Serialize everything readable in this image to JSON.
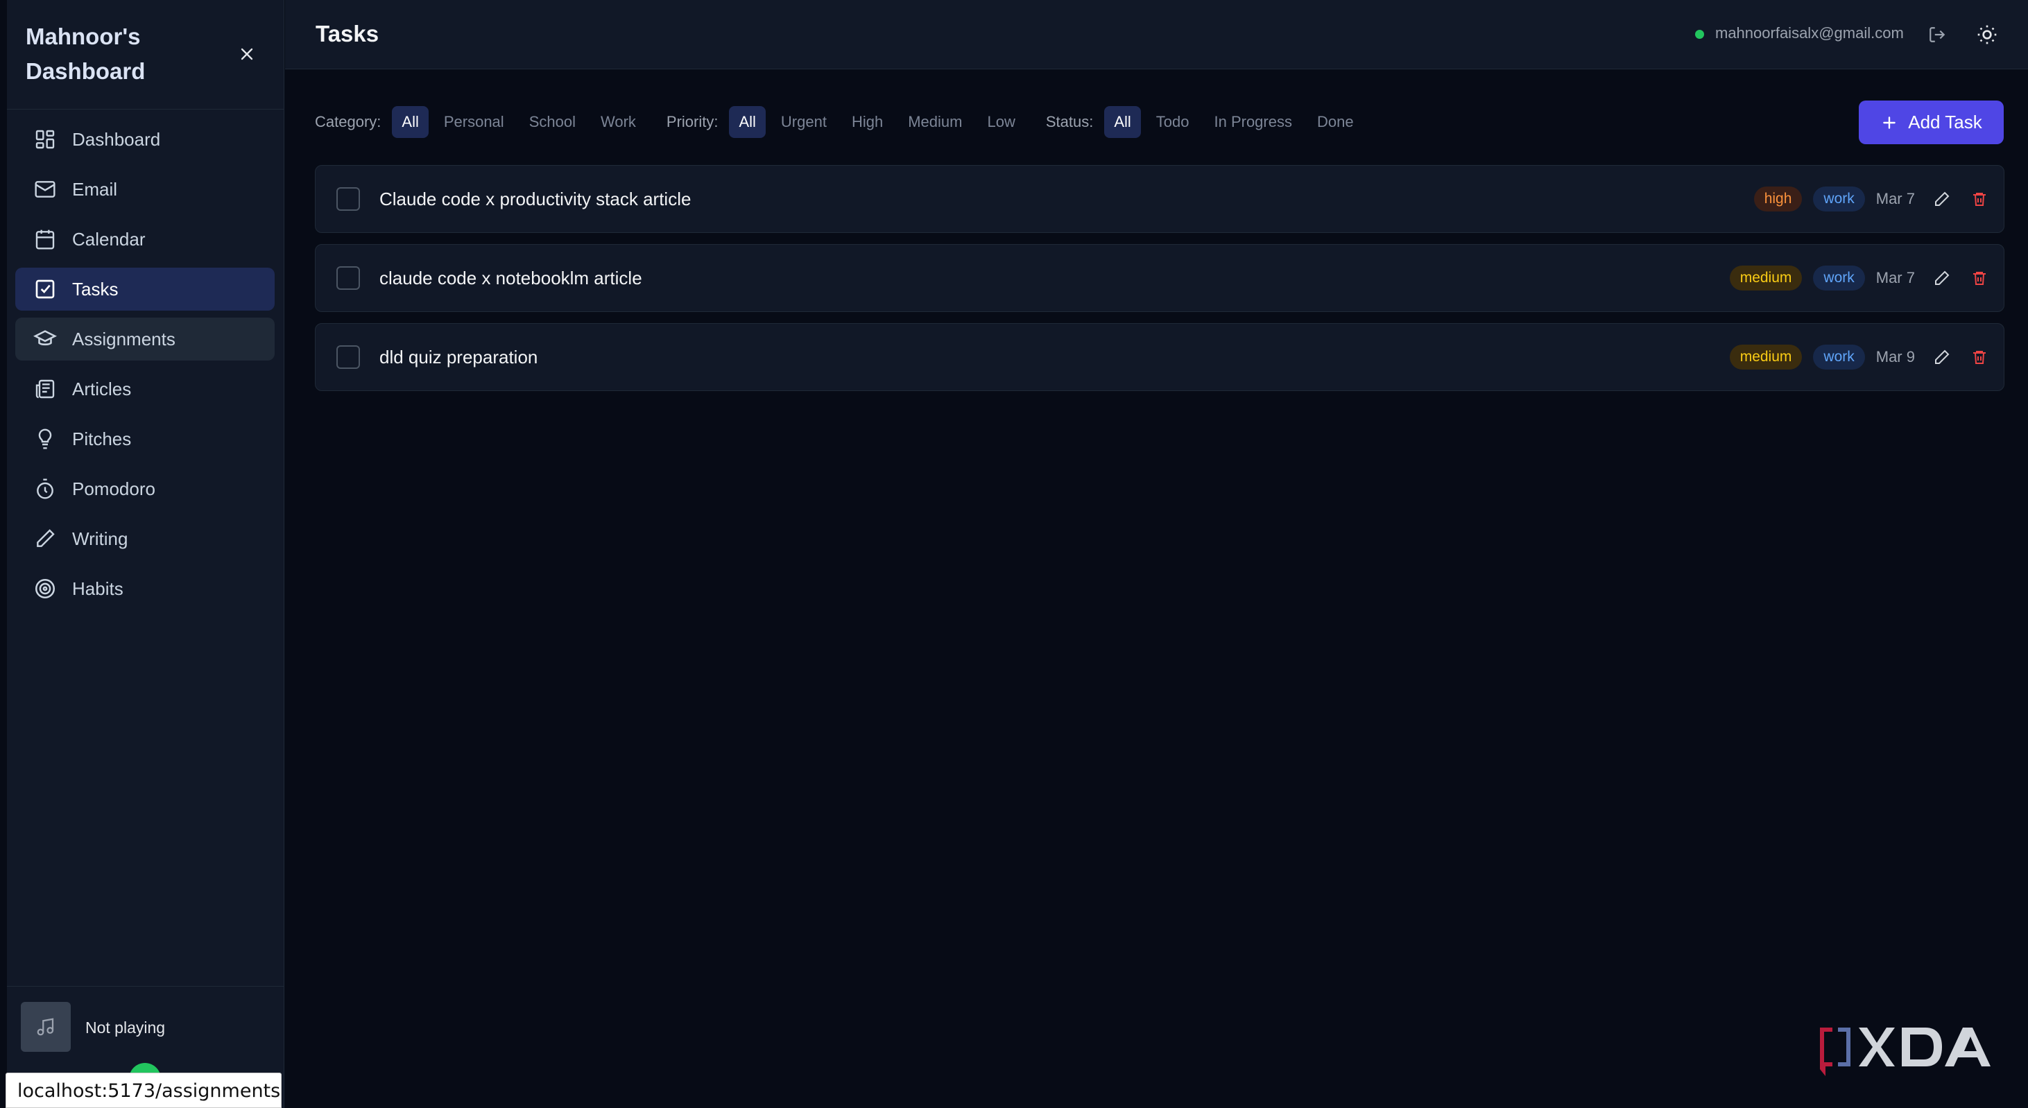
{
  "sidebar": {
    "brand": "Mahnoor's Dashboard",
    "items": [
      {
        "label": "Dashboard",
        "icon": "dashboard-icon"
      },
      {
        "label": "Email",
        "icon": "mail-icon"
      },
      {
        "label": "Calendar",
        "icon": "calendar-icon"
      },
      {
        "label": "Tasks",
        "icon": "tasks-icon",
        "active": true
      },
      {
        "label": "Assignments",
        "icon": "graduation-cap-icon",
        "hover": true
      },
      {
        "label": "Articles",
        "icon": "newspaper-icon"
      },
      {
        "label": "Pitches",
        "icon": "lightbulb-icon"
      },
      {
        "label": "Pomodoro",
        "icon": "timer-icon"
      },
      {
        "label": "Writing",
        "icon": "pen-icon"
      },
      {
        "label": "Habits",
        "icon": "target-icon"
      }
    ],
    "player": {
      "label": "Not playing",
      "icon": "music-icon"
    }
  },
  "status_bar_url": "localhost:5173/assignments",
  "header": {
    "title": "Tasks",
    "user_email": "mahnoorfaisalx@gmail.com",
    "online_color": "#22c55e"
  },
  "filters": {
    "category": {
      "label": "Category:",
      "options": [
        "All",
        "Personal",
        "School",
        "Work"
      ],
      "selected": "All"
    },
    "priority": {
      "label": "Priority:",
      "options": [
        "All",
        "Urgent",
        "High",
        "Medium",
        "Low"
      ],
      "selected": "All"
    },
    "status": {
      "label": "Status:",
      "options": [
        "All",
        "Todo",
        "In Progress",
        "Done"
      ],
      "selected": "All"
    }
  },
  "add_task_label": "Add Task",
  "tasks": [
    {
      "title": "Claude code x productivity stack article",
      "priority": "high",
      "category": "work",
      "date": "Mar 7"
    },
    {
      "title": "claude code x notebooklm article",
      "priority": "medium",
      "category": "work",
      "date": "Mar 7"
    },
    {
      "title": "dld quiz preparation",
      "priority": "medium",
      "category": "work",
      "date": "Mar 9"
    }
  ],
  "colors": {
    "accent": "#4f46e5",
    "active_nav": "#1e2a55",
    "delete": "#ef4444"
  },
  "watermark": "XDA"
}
